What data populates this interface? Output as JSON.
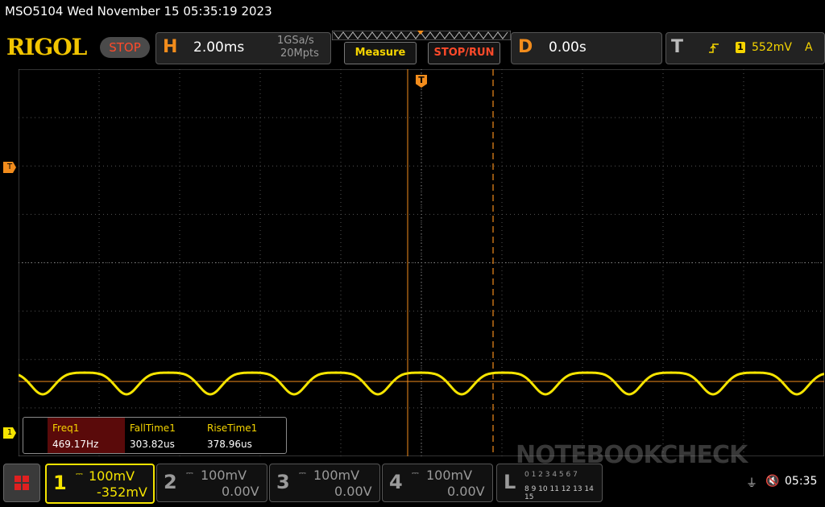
{
  "header": {
    "title": "MSO5104  Wed November 15 05:35:19 2023"
  },
  "brand": {
    "logo": "RIGOL",
    "run_state": "STOP"
  },
  "horizontal": {
    "letter": "H",
    "timebase": "2.00ms",
    "sample_rate": "1GSa/s",
    "memory_depth": "20Mpts"
  },
  "buttons": {
    "measure": "Measure",
    "stop_run": "STOP/RUN"
  },
  "delay": {
    "letter": "D",
    "value": "0.00s"
  },
  "trigger": {
    "letter": "T",
    "source": "1",
    "level": "552mV",
    "mode": "A"
  },
  "markers": {
    "trigger_level": "T",
    "ch1_ground": "1",
    "trigger_pos": "T"
  },
  "measurements": [
    {
      "name": "Freq1",
      "value": "469.17Hz"
    },
    {
      "name": "FallTime1",
      "value": "303.82us"
    },
    {
      "name": "RiseTime1",
      "value": "378.96us"
    }
  ],
  "channels": [
    {
      "num": "1",
      "scale": "100mV",
      "offset": "-352mV",
      "color": "#f5e400",
      "active": true
    },
    {
      "num": "2",
      "scale": "100mV",
      "offset": "0.00V",
      "color": "#8a8a8a",
      "active": false
    },
    {
      "num": "3",
      "scale": "100mV",
      "offset": "0.00V",
      "color": "#8a8a8a",
      "active": false
    },
    {
      "num": "4",
      "scale": "100mV",
      "offset": "0.00V",
      "color": "#8a8a8a",
      "active": false
    }
  ],
  "logic": {
    "letter": "L",
    "row1": "0 1 2 3 4 5 6 7",
    "row2": "8 9 10 11 12 13 14 15"
  },
  "status": {
    "time": "05:35"
  },
  "watermark": "NOTEBOOKCHECK",
  "colors": {
    "trace": "#f5e400",
    "accent": "#f28c1c",
    "stop": "#ff4a2a"
  }
}
